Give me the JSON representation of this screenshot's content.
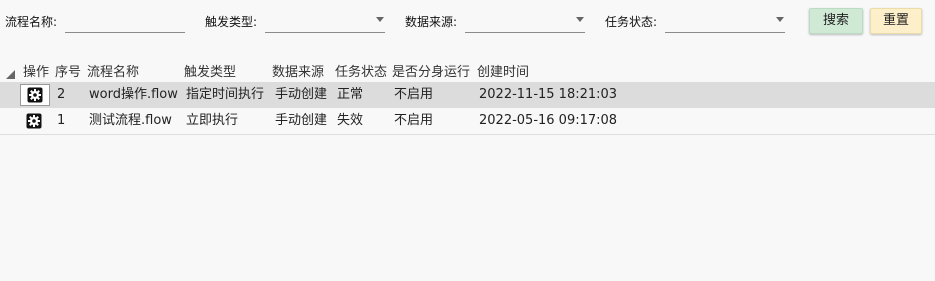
{
  "filters": {
    "flow_name_label": "流程名称:",
    "trigger_type_label": "触发类型:",
    "data_source_label": "数据来源:",
    "task_status_label": "任务状态:"
  },
  "buttons": {
    "search": "搜索",
    "reset": "重置"
  },
  "table": {
    "headers": [
      "操作",
      "序号",
      "流程名称",
      "触发类型",
      "数据来源",
      "任务状态",
      "是否分身运行",
      "创建时间"
    ],
    "rows": [
      {
        "index": "2",
        "name": "word操作.flow",
        "trigger": "指定时间执行",
        "source": "手动创建",
        "status": "正常",
        "clone": "不启用",
        "created": "2022-11-15 18:21:03"
      },
      {
        "index": "1",
        "name": "测试流程.flow",
        "trigger": "立即执行",
        "source": "手动创建",
        "status": "失效",
        "clone": "不启用",
        "created": "2022-05-16 09:17:08"
      }
    ]
  },
  "colors": {
    "search_bg": "#cfe9d5",
    "reset_bg": "#fcefc9",
    "selected_row": "#dcdcdc"
  },
  "icons": {
    "row_action": "gear-icon",
    "corner": "select-all-triangle-icon"
  }
}
